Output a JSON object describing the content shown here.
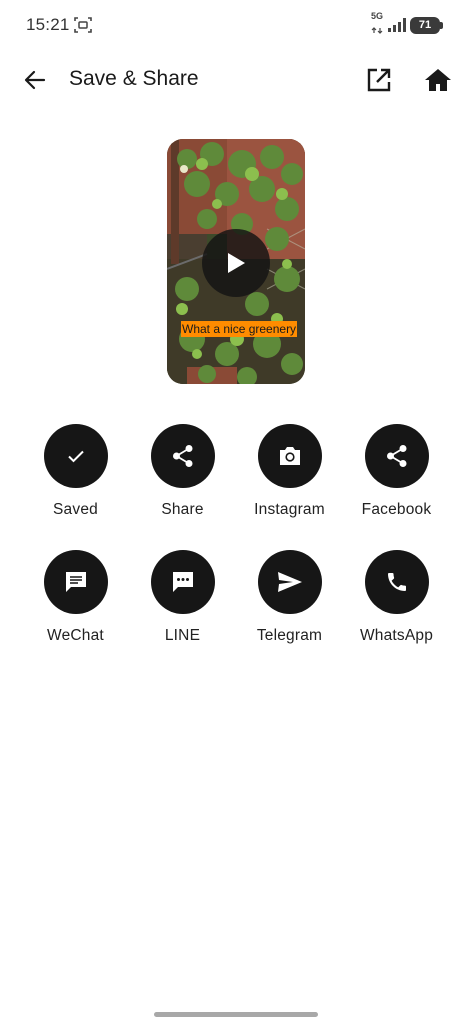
{
  "status_bar": {
    "time": "15:21",
    "network": "5G",
    "battery": "71",
    "scan_icon": "screen-record-icon"
  },
  "header": {
    "title": "Save & Share",
    "back_icon": "arrow-left-icon",
    "open_icon": "open-external-icon",
    "home_icon": "home-icon"
  },
  "preview": {
    "caption": "What a nice greenery",
    "caption_color": "#ff8c00",
    "play_icon": "play-icon"
  },
  "share_options": [
    {
      "id": "saved",
      "label": "Saved",
      "icon": "check-icon"
    },
    {
      "id": "share",
      "label": "Share",
      "icon": "share-icon"
    },
    {
      "id": "instagram",
      "label": "Instagram",
      "icon": "camera-icon"
    },
    {
      "id": "facebook",
      "label": "Facebook",
      "icon": "share-icon"
    },
    {
      "id": "wechat",
      "label": "WeChat",
      "icon": "chat-lines-icon"
    },
    {
      "id": "line",
      "label": "LINE",
      "icon": "chat-dots-icon"
    },
    {
      "id": "telegram",
      "label": "Telegram",
      "icon": "send-icon"
    },
    {
      "id": "whatsapp",
      "label": "WhatsApp",
      "icon": "phone-icon"
    }
  ],
  "colors": {
    "icon_circle": "#161616",
    "text": "#1a1a1a",
    "background": "#ffffff"
  }
}
